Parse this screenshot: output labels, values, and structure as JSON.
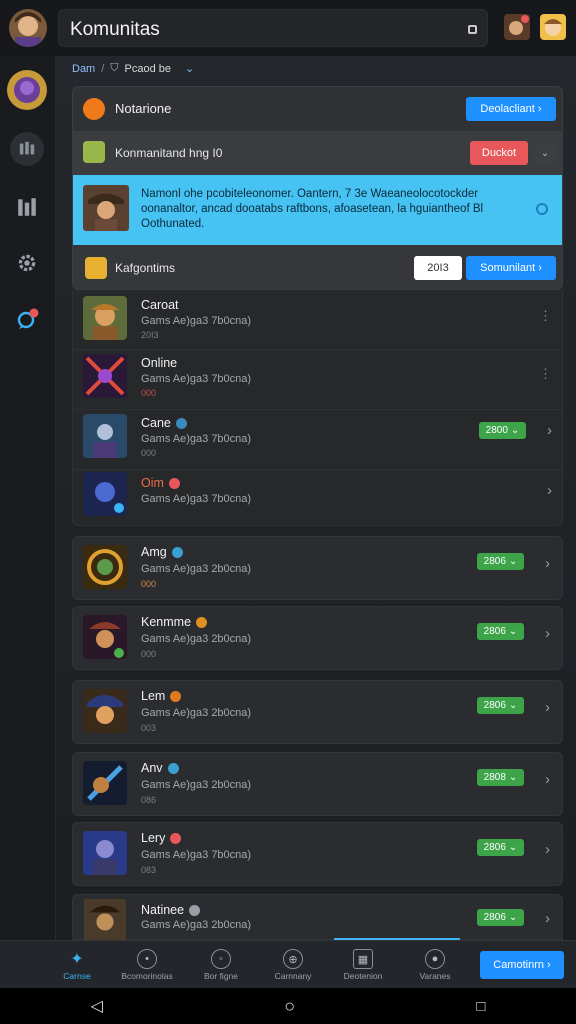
{
  "header": {
    "title": "Komunitas"
  },
  "breadcrumb": {
    "root": "Dam",
    "sep": "/",
    "current": "Pcaod be"
  },
  "panel": {
    "row1": {
      "label": "Notarione",
      "button": "Deolacliant"
    },
    "row2": {
      "label": "Konmanitand hng I0",
      "button": "Duckot"
    },
    "notice": {
      "text": "Namonl ohe pcobiteleonomer. Oantern, 7 3e Waeaneolocotockder oonanaltor, ancad dooatabs raftbons, afoasetean, la hguiantheof Bl Oothunated."
    },
    "row3": {
      "label": "Kafgontims",
      "input_value": "20I3",
      "button": "Somunilant"
    }
  },
  "list": [
    {
      "name": "Caroat",
      "sub": "Gams Ae)ga3 7b0cna)",
      "meta": "20I3"
    },
    {
      "name": "Online",
      "sub": "Gams Ae)ga3 7b0cna)",
      "meta": "000"
    },
    {
      "name": "Cane",
      "sub": "Gams Ae)ga3 7b0cna)",
      "meta": "000",
      "chip": "2800"
    },
    {
      "name": "Oim",
      "sub": "Gams Ae)ga3 7b0cna)",
      "meta": "",
      "chip": ""
    }
  ],
  "cards": [
    {
      "name": "Amg",
      "sub": "Gams Ae)ga3 2b0cna)",
      "meta": "000",
      "chip": "2806"
    },
    {
      "name": "Kenmme",
      "sub": "Gams Ae)ga3 2b0cna)",
      "meta": "000",
      "chip": "2806"
    },
    {
      "name": "Lem",
      "sub": "Gams Ae)ga3 2b0cna)",
      "meta": "003",
      "chip": "2806"
    },
    {
      "name": "Anv",
      "sub": "Gams Ae)ga3 2b0cna)",
      "meta": "086",
      "chip": "2808"
    },
    {
      "name": "Lery",
      "sub": "Gams Ae)ga3 7b0cna)",
      "meta": "083",
      "chip": "2806"
    },
    {
      "name": "Natinee",
      "sub": "Gams Ae)ga3 2b0cna)",
      "meta": "",
      "chip": "2806"
    }
  ],
  "bottom_nav": {
    "tabs": [
      "Carnse",
      "Bcomorinolas",
      "Bor figne",
      "Carnnany",
      "Deotenion",
      "Varanes"
    ],
    "cta": "Camotinrn"
  },
  "colors": {
    "accent": "#1e90ff",
    "notice": "#46c3f2",
    "chip": "#3da44a",
    "danger": "#e8585a"
  }
}
